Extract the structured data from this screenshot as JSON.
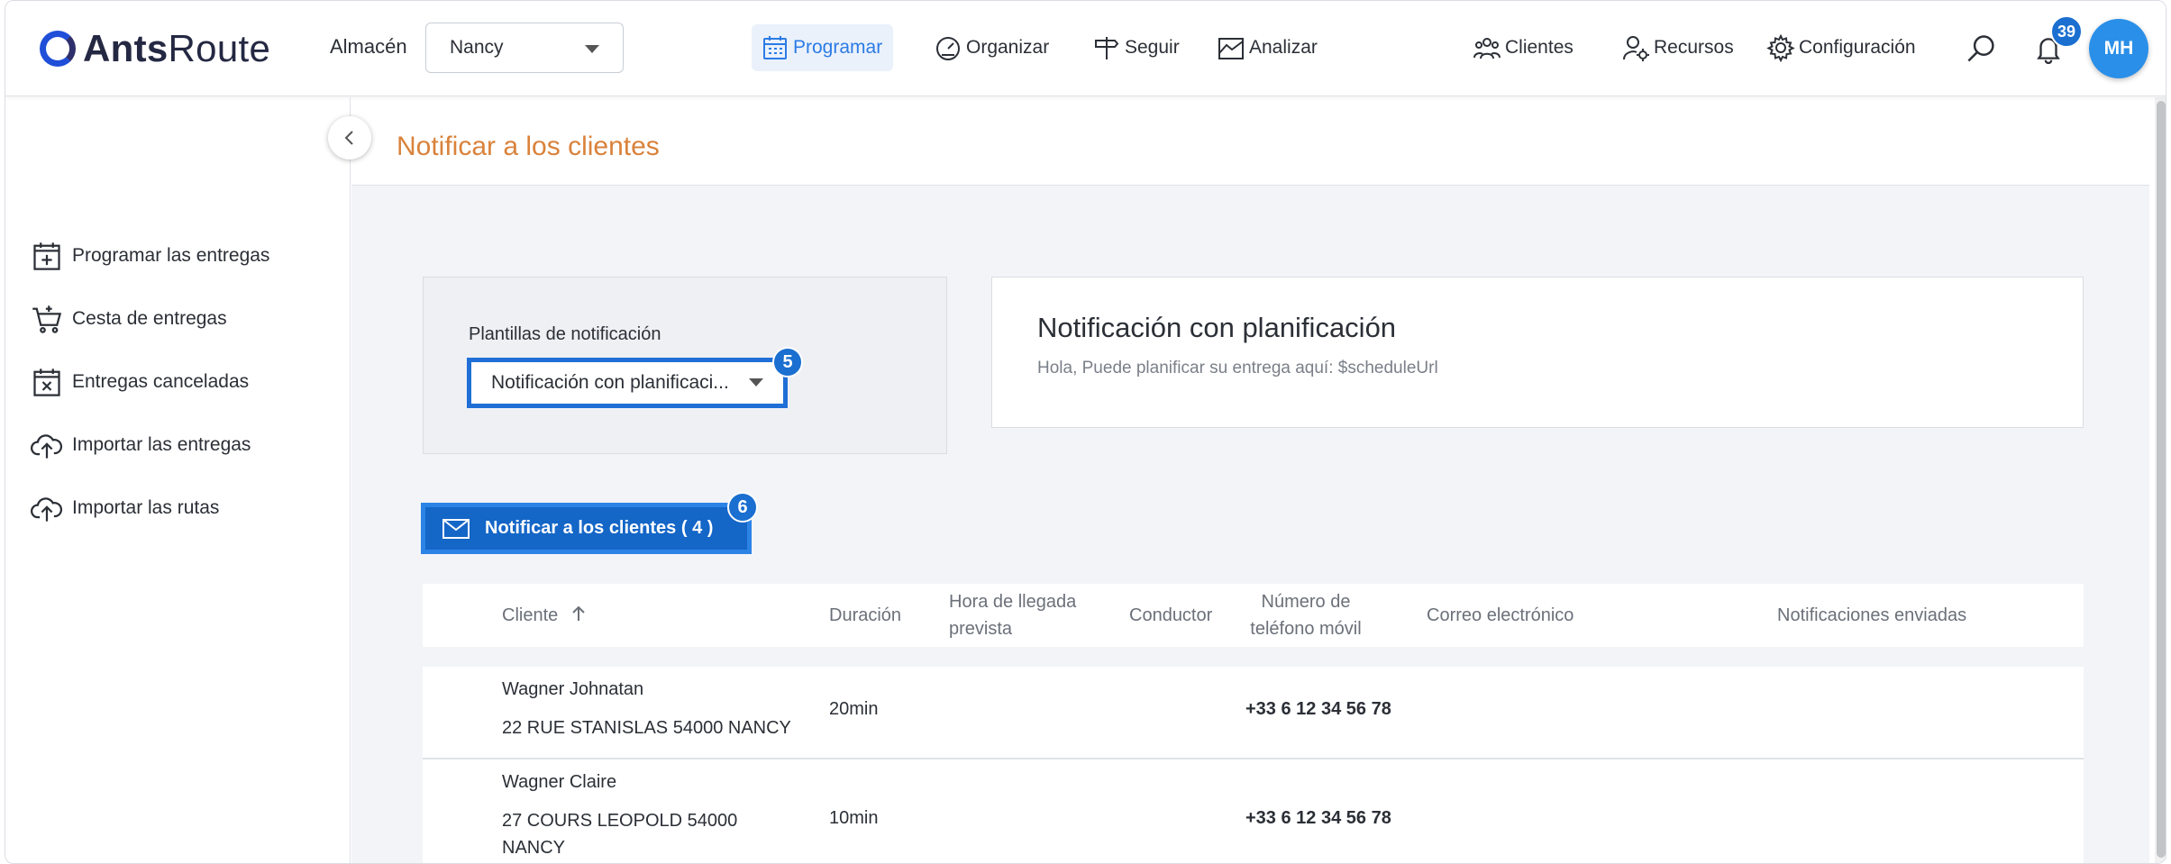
{
  "brand": {
    "name_bold": "Ants",
    "name_regular": "Route"
  },
  "topbar": {
    "almacen_label": "Almacén",
    "almacen_value": "Nancy",
    "nav": [
      {
        "label": "Programar",
        "icon": "calendar-icon",
        "active": true
      },
      {
        "label": "Organizar",
        "icon": "gauge-icon",
        "active": false
      },
      {
        "label": "Seguir",
        "icon": "signpost-icon",
        "active": false
      },
      {
        "label": "Analizar",
        "icon": "chart-icon",
        "active": false
      }
    ],
    "right_nav": [
      {
        "label": "Clientes",
        "icon": "users-icon"
      },
      {
        "label": "Recursos",
        "icon": "user-gear-icon"
      },
      {
        "label": "Configuración",
        "icon": "gear-icon"
      }
    ],
    "notifications_count": "39",
    "avatar_initials": "MH"
  },
  "sidebar": {
    "items": [
      {
        "label": "Programar las entregas",
        "icon": "calendar-plus-icon"
      },
      {
        "label": "Cesta de entregas",
        "icon": "cart-icon"
      },
      {
        "label": "Entregas canceladas",
        "icon": "calendar-x-icon"
      },
      {
        "label": "Importar las entregas",
        "icon": "cloud-upload-icon"
      },
      {
        "label": "Importar las rutas",
        "icon": "cloud-upload-icon"
      }
    ]
  },
  "main": {
    "title": "Notificar a los clientes",
    "templates_label": "Plantillas de notificación",
    "template_selected": "Notificación con planificaci...",
    "preview_title": "Notificación con planificación",
    "preview_body": "Hola, Puede planificar su entrega aquí: $scheduleUrl",
    "notify_button": "Notificar a los clientes ( 4 )",
    "step_badges": {
      "template": "5",
      "notify": "6"
    }
  },
  "table": {
    "headers": {
      "cliente": "Cliente",
      "duracion": "Duración",
      "hora_1": "Hora de llegada",
      "hora_2": "prevista",
      "conductor": "Conductor",
      "telefono_1": "Número de",
      "telefono_2": "teléfono móvil",
      "correo": "Correo electrónico",
      "notificaciones": "Notificaciones enviadas"
    },
    "rows": [
      {
        "name": "Wagner Johnatan",
        "address_1": "22 RUE STANISLAS 54000 NANCY",
        "address_2": "",
        "duration": "20min",
        "phone": "+33 6 12 34 56 78"
      },
      {
        "name": "Wagner Claire",
        "address_1": "27 COURS LEOPOLD 54000",
        "address_2": "NANCY",
        "duration": "10min",
        "phone": "+33 6 12 34 56 78"
      }
    ]
  },
  "colors": {
    "accent": "#2c7be5",
    "title_orange": "#d9823b",
    "highlight_blue": "#1f6fd6",
    "button_blue": "#1466c7"
  }
}
